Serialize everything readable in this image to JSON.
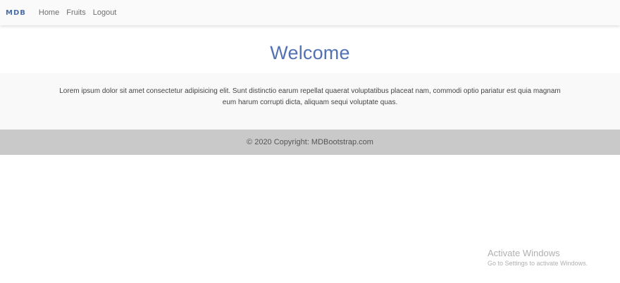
{
  "navbar": {
    "brand": "MDB",
    "links": [
      "Home",
      "Fruits",
      "Logout"
    ]
  },
  "main": {
    "title": "Welcome",
    "intro": "Lorem ipsum dolor sit amet consectetur adipisicing elit. Sunt distinctio earum repellat quaerat voluptatibus placeat nam, commodi optio pariatur est quia magnam eum harum corrupti dicta, aliquam sequi voluptate quas."
  },
  "footer": {
    "copyright": "© 2020 Copyright: MDBootstrap.com"
  },
  "watermark": {
    "title": "Activate Windows",
    "subtitle": "Go to Settings to activate Windows."
  },
  "colors": {
    "brand": "#4b6da8",
    "title": "#5272b4",
    "navbar_bg": "#fafafa",
    "intro_bg": "#f9f9f9",
    "footer_bg": "#c9c9c9"
  }
}
